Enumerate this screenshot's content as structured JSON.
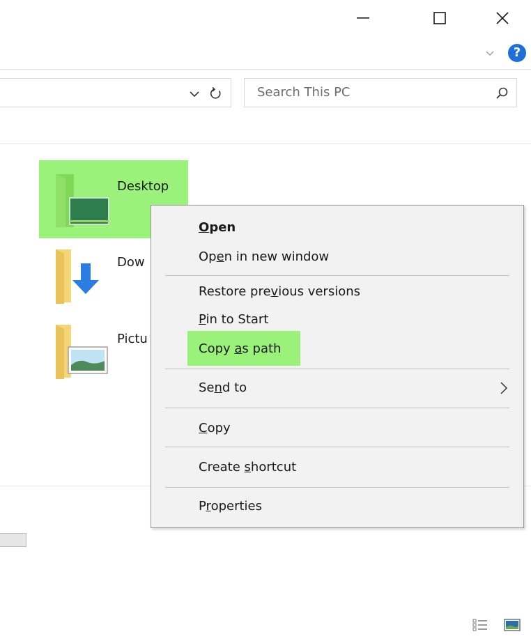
{
  "window": {
    "controls": [
      "minimize",
      "maximize",
      "close"
    ],
    "help_label": "?"
  },
  "search": {
    "placeholder": "Search This PC"
  },
  "items": [
    {
      "name": "Desktop",
      "selected": true
    },
    {
      "name": "Dow",
      "icon": "downloads-folder-icon"
    },
    {
      "name": "Pictu",
      "icon": "pictures-folder-icon"
    }
  ],
  "context_menu": {
    "items": [
      {
        "label": "Open",
        "bold": true,
        "mnemonic": "O"
      },
      {
        "label": "Open in new window",
        "mnemonic": "e"
      },
      {
        "label": "Restore previous versions",
        "mnemonic": "v"
      },
      {
        "label": "Pin to Start",
        "mnemonic": "P"
      },
      {
        "label": "Copy as path",
        "mnemonic": "a",
        "highlighted": true
      },
      {
        "label": "Send to",
        "mnemonic": "n",
        "submenu": true
      },
      {
        "label": "Copy",
        "mnemonic": "C"
      },
      {
        "label": "Create shortcut",
        "mnemonic": "s"
      },
      {
        "label": "Properties",
        "mnemonic": "r"
      }
    ]
  },
  "colors": {
    "highlight": "#9af27b",
    "menu_background": "#f2f2f2",
    "help_blue": "#1e6fd9",
    "folder_yellow": "#f4d676"
  }
}
